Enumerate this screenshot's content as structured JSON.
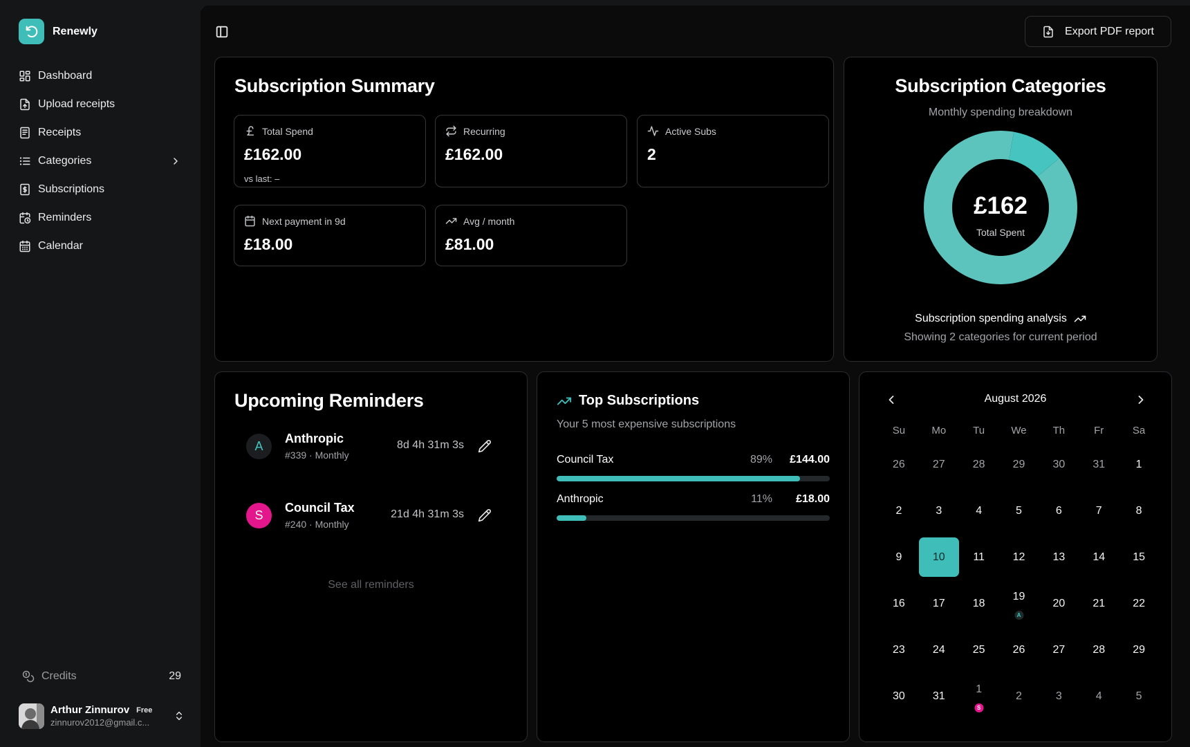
{
  "brand": {
    "name": "Renewly"
  },
  "nav": [
    {
      "label": "Dashboard",
      "icon": "dashboard-icon"
    },
    {
      "label": "Upload receipts",
      "icon": "file-upload-icon"
    },
    {
      "label": "Receipts",
      "icon": "receipt-icon"
    },
    {
      "label": "Categories",
      "icon": "list-icon"
    },
    {
      "label": "Subscriptions",
      "icon": "dollar-file-icon"
    },
    {
      "label": "Reminders",
      "icon": "calendar-clock-icon"
    },
    {
      "label": "Calendar",
      "icon": "calendar-icon"
    }
  ],
  "credits": {
    "label": "Credits",
    "value": "29"
  },
  "user": {
    "name": "Arthur Zinnurov",
    "plan": "Free",
    "email": "zinnurov2012@gmail.c..."
  },
  "header": {
    "export_label": "Export PDF report"
  },
  "summary": {
    "title": "Subscription Summary",
    "stats": [
      {
        "label": "Total Spend",
        "value": "£162.00",
        "sub": "vs last: –",
        "icon": "pound-icon"
      },
      {
        "label": "Recurring",
        "value": "£162.00",
        "icon": "repeat-icon"
      },
      {
        "label": "Active Subs",
        "value": "2",
        "icon": "activity-icon"
      },
      {
        "label": "Next payment in 9d",
        "value": "£18.00",
        "icon": "calendar-icon"
      },
      {
        "label": "Avg / month",
        "value": "£81.00",
        "icon": "trending-up-icon"
      }
    ]
  },
  "categories": {
    "title": "Subscription Categories",
    "subtitle": "Monthly spending breakdown",
    "center_value": "£162",
    "center_label": "Total Spent",
    "analysis": "Subscription spending analysis",
    "period": "Showing 2 categories for current period",
    "colors": {
      "primary": "#5cc3bd",
      "secondary": "#45c4c0"
    }
  },
  "chart_data": {
    "type": "pie",
    "categories": [
      "Council Tax",
      "Anthropic"
    ],
    "values": [
      144,
      18
    ]
  },
  "reminders": {
    "title": "Upcoming Reminders",
    "items": [
      {
        "name": "Anthropic",
        "meta": "#339  ·  Monthly",
        "countdown": "8d 4h 31m 3s",
        "initial": "A",
        "color": "#1b1d20",
        "text_color": "#45c4c0"
      },
      {
        "name": "Council Tax",
        "meta": "#240  ·  Monthly",
        "countdown": "21d 4h 31m 3s",
        "initial": "S",
        "color": "#e3168c",
        "text_color": "#ffffff"
      }
    ],
    "see_all": "See all reminders"
  },
  "top_subscriptions": {
    "title": "Top Subscriptions",
    "subtitle": "Your 5 most expensive subscriptions",
    "items": [
      {
        "name": "Council Tax",
        "percent": "89%",
        "amount": "£144.00",
        "fraction": 0.89
      },
      {
        "name": "Anthropic",
        "percent": "11%",
        "amount": "£18.00",
        "fraction": 0.11
      }
    ]
  },
  "calendar": {
    "month": "August 2026",
    "weekdays": [
      "Su",
      "Mo",
      "Tu",
      "We",
      "Th",
      "Fr",
      "Sa"
    ],
    "weeks": [
      [
        {
          "d": "26",
          "m": true
        },
        {
          "d": "27",
          "m": true
        },
        {
          "d": "28",
          "m": true
        },
        {
          "d": "29",
          "m": true
        },
        {
          "d": "30",
          "m": true
        },
        {
          "d": "31",
          "m": true
        },
        {
          "d": "1"
        }
      ],
      [
        {
          "d": "2"
        },
        {
          "d": "3"
        },
        {
          "d": "4"
        },
        {
          "d": "5"
        },
        {
          "d": "6"
        },
        {
          "d": "7"
        },
        {
          "d": "8"
        }
      ],
      [
        {
          "d": "9"
        },
        {
          "d": "10",
          "today": true
        },
        {
          "d": "11"
        },
        {
          "d": "12"
        },
        {
          "d": "13"
        },
        {
          "d": "14"
        },
        {
          "d": "15"
        }
      ],
      [
        {
          "d": "16"
        },
        {
          "d": "17"
        },
        {
          "d": "18"
        },
        {
          "d": "19",
          "event": "A",
          "event_color": "#1f2a2a",
          "event_text": "#45c4c0"
        },
        {
          "d": "20"
        },
        {
          "d": "21"
        },
        {
          "d": "22"
        }
      ],
      [
        {
          "d": "23"
        },
        {
          "d": "24"
        },
        {
          "d": "25"
        },
        {
          "d": "26"
        },
        {
          "d": "27"
        },
        {
          "d": "28"
        },
        {
          "d": "29"
        }
      ],
      [
        {
          "d": "30"
        },
        {
          "d": "31"
        },
        {
          "d": "1",
          "m": true,
          "event": "S",
          "event_color": "#e3168c",
          "event_text": "#ffffff"
        },
        {
          "d": "2",
          "m": true
        },
        {
          "d": "3",
          "m": true
        },
        {
          "d": "4",
          "m": true
        },
        {
          "d": "5",
          "m": true
        }
      ]
    ]
  }
}
